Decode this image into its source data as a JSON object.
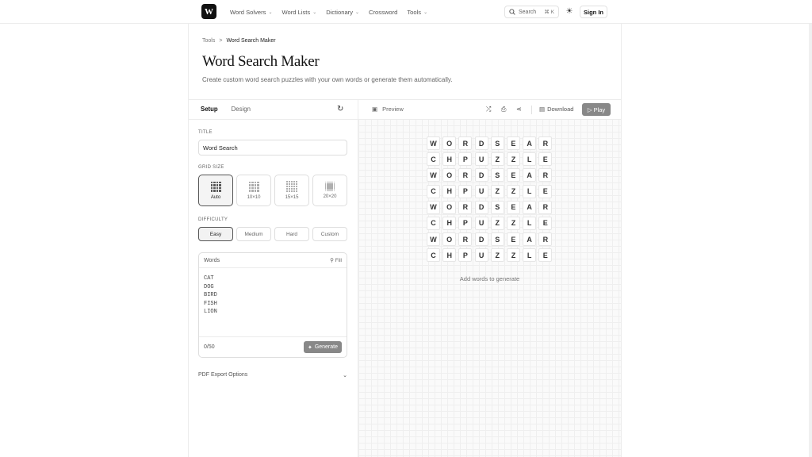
{
  "header": {
    "logo_text": "W",
    "nav": [
      {
        "label": "Word Solvers",
        "dropdown": true
      },
      {
        "label": "Word Lists",
        "dropdown": true
      },
      {
        "label": "Dictionary",
        "dropdown": true
      },
      {
        "label": "Crossword",
        "dropdown": false
      },
      {
        "label": "Tools",
        "dropdown": true
      }
    ],
    "search_label": "Search",
    "search_shortcut": "⌘ K",
    "signin_label": "Sign In"
  },
  "breadcrumb": {
    "parent": "Tools",
    "separator": ">",
    "current": "Word Search Maker"
  },
  "page": {
    "title": "Word Search Maker",
    "description": "Create custom word search puzzles with your own words or generate them automatically."
  },
  "setup": {
    "tabs": [
      "Setup",
      "Design"
    ],
    "active_tab": "Setup",
    "title_label": "TITLE",
    "title_value": "Word Search",
    "grid_size_label": "GRID SIZE",
    "grid_sizes": [
      "Auto",
      "10×10",
      "15×15",
      "20×20"
    ],
    "active_grid_size": "Auto",
    "difficulty_label": "DIFFICULTY",
    "difficulties": [
      "Easy",
      "Medium",
      "Hard",
      "Custom"
    ],
    "active_difficulty": "Easy",
    "words_label": "Words",
    "fill_label": "Fill",
    "words": [
      "CAT",
      "DOG",
      "BIRD",
      "FISH",
      "LION"
    ],
    "word_count": "0/50",
    "generate_label": "Generate",
    "pdf_label": "PDF Export Options"
  },
  "preview": {
    "label": "Preview",
    "download_label": "Download",
    "play_label": "Play",
    "grid": [
      [
        "W",
        "O",
        "R",
        "D",
        "S",
        "E",
        "A",
        "R"
      ],
      [
        "C",
        "H",
        "P",
        "U",
        "Z",
        "Z",
        "L",
        "E"
      ],
      [
        "W",
        "O",
        "R",
        "D",
        "S",
        "E",
        "A",
        "R"
      ],
      [
        "C",
        "H",
        "P",
        "U",
        "Z",
        "Z",
        "L",
        "E"
      ],
      [
        "W",
        "O",
        "R",
        "D",
        "S",
        "E",
        "A",
        "R"
      ],
      [
        "C",
        "H",
        "P",
        "U",
        "Z",
        "Z",
        "L",
        "E"
      ],
      [
        "W",
        "O",
        "R",
        "D",
        "S",
        "E",
        "A",
        "R"
      ],
      [
        "C",
        "H",
        "P",
        "U",
        "Z",
        "Z",
        "L",
        "E"
      ]
    ],
    "hint": "Add words to generate"
  },
  "icons": {
    "theme": "sun-icon",
    "reset": "rotate-ccw-icon",
    "shuffle": "shuffle-icon",
    "save": "save-icon",
    "share": "share-icon"
  }
}
